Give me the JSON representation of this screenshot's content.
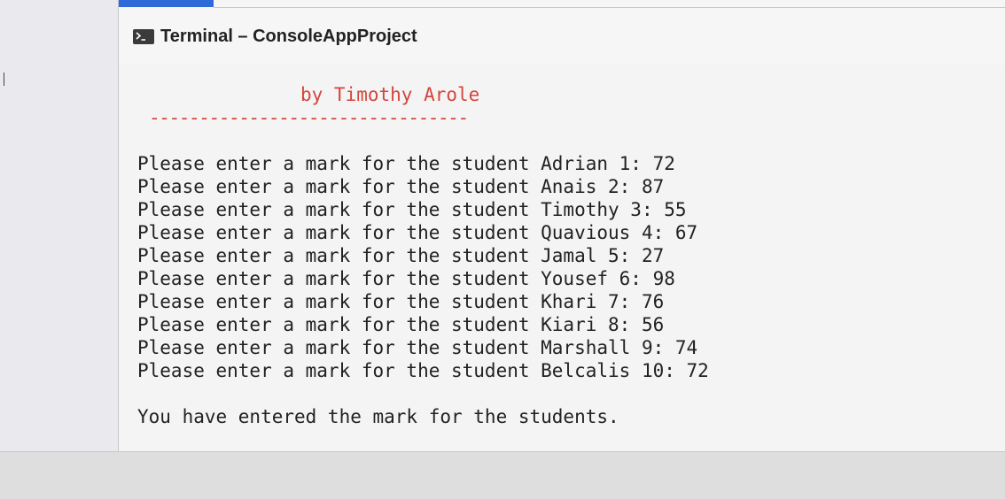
{
  "window": {
    "title": "Terminal – ConsoleAppProject"
  },
  "icons": {
    "terminal": "terminal-icon"
  },
  "colors": {
    "accent": "#2f6bd8",
    "banner": "#d4453a",
    "text": "#222222"
  },
  "console": {
    "banner_author": "by Timothy Arole",
    "banner_underline": "--------------------------------",
    "entries": [
      {
        "text": "Please enter a mark for the student Adrian 1: 72"
      },
      {
        "text": "Please enter a mark for the student Anais 2: 87"
      },
      {
        "text": "Please enter a mark for the student Timothy 3: 55"
      },
      {
        "text": "Please enter a mark for the student Quavious 4: 67"
      },
      {
        "text": "Please enter a mark for the student Jamal 5: 27"
      },
      {
        "text": "Please enter a mark for the student Yousef 6: 98"
      },
      {
        "text": "Please enter a mark for the student Khari 7: 76"
      },
      {
        "text": "Please enter a mark for the student Kiari 8: 56"
      },
      {
        "text": "Please enter a mark for the student Marshall 9: 74"
      },
      {
        "text": "Please enter a mark for the student Belcalis 10: 72"
      }
    ],
    "summary": "You have entered the mark for the students."
  }
}
